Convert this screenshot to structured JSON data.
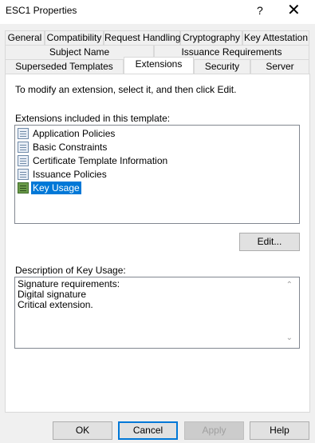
{
  "window": {
    "title": "ESC1 Properties",
    "help": "?",
    "close": "✕"
  },
  "tabs": {
    "row1": [
      "General",
      "Compatibility",
      "Request Handling",
      "Cryptography",
      "Key Attestation"
    ],
    "row2": [
      "Subject Name",
      "Issuance Requirements"
    ],
    "row3": [
      "Superseded Templates",
      "Extensions",
      "Security",
      "Server"
    ],
    "active": "Extensions"
  },
  "extensions_page": {
    "instruction": "To modify an extension, select it, and then click Edit.",
    "list_label": "Extensions included in this template:",
    "items": [
      {
        "label": "Application Policies",
        "selected": false
      },
      {
        "label": "Basic Constraints",
        "selected": false
      },
      {
        "label": "Certificate Template Information",
        "selected": false
      },
      {
        "label": "Issuance Policies",
        "selected": false
      },
      {
        "label": "Key Usage",
        "selected": true
      }
    ],
    "edit_button": "Edit...",
    "description_label": "Description of Key Usage:",
    "description_lines": [
      "Signature requirements:",
      "Digital signature",
      "Critical extension."
    ]
  },
  "buttons": {
    "ok": "OK",
    "cancel": "Cancel",
    "apply": "Apply",
    "help": "Help"
  },
  "colors": {
    "selection": "#0078d7",
    "dialog_bg": "#f0f0f0"
  }
}
